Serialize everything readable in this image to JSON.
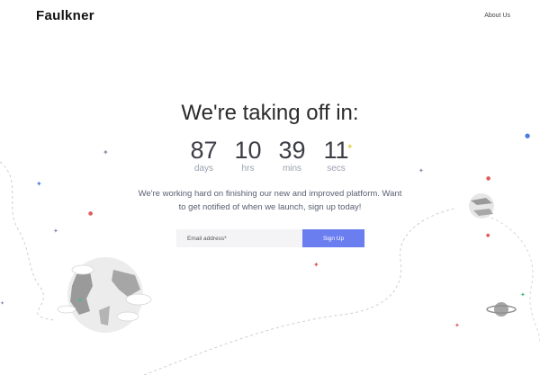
{
  "brand": {
    "name": "Faulkner"
  },
  "nav": {
    "about_label": "About Us"
  },
  "hero": {
    "headline": "We're taking off in:",
    "countdown": [
      {
        "value": "87",
        "label": "days"
      },
      {
        "value": "10",
        "label": "hrs"
      },
      {
        "value": "39",
        "label": "mins"
      },
      {
        "value": "11",
        "label": "secs"
      }
    ],
    "description_line1": "We're working hard on finishing our new and improved platform. Want",
    "description_line2": "to get notified of when we launch, sign up today!"
  },
  "signup": {
    "email_placeholder": "Email address*",
    "button_label": "Sign Up",
    "button_color": "#6b7ef0"
  },
  "decorations": {
    "icons": [
      "earth-icon",
      "planet-icon",
      "saturn-icon",
      "sparkle-icon"
    ],
    "star_colors": [
      "#e05a5a",
      "#4a7de0",
      "#3cc07a",
      "#e8d24a",
      "#8a8aa8"
    ]
  }
}
